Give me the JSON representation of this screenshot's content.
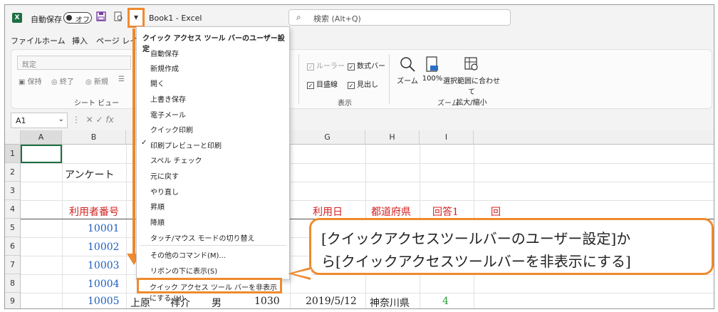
{
  "titlebar": {
    "logo": "X",
    "autosave_label": "自動保存",
    "autosave_state": "オフ",
    "book_title": "Book1 - Excel",
    "qa_dropdown_glyph": "▾",
    "search_placeholder": "検索 (Alt+Q)"
  },
  "tabs": [
    "ファイル",
    "ホーム",
    "挿入",
    "ページ レイ"
  ],
  "ribbon": {
    "sheetview_select": "既定",
    "sheetview_buttons": [
      "保持",
      "終了",
      "新規",
      "☰"
    ],
    "sheetview_label": "シート ビュー",
    "show_checks": [
      {
        "label": "ルーラー",
        "checked": true,
        "dim": true
      },
      {
        "label": "数式バー",
        "checked": true,
        "dim": false
      },
      {
        "label": "目盛線",
        "checked": true,
        "dim": false
      },
      {
        "label": "見出し",
        "checked": true,
        "dim": false
      }
    ],
    "show_label": "表示",
    "zoom_buttons": [
      "ズーム",
      "100%",
      "選択範囲に合わせて",
      "拡大/縮小"
    ],
    "zoom_label": "ズーム"
  },
  "formula_bar": {
    "name_box": "A1",
    "fx": "fx"
  },
  "grid": {
    "columns": [
      "A",
      "B",
      "G",
      "H",
      "I"
    ],
    "rows": [
      "1",
      "2",
      "3",
      "4",
      "5",
      "6",
      "7",
      "8",
      "9"
    ],
    "title_cell": "アンケート",
    "header_b": "利用者番号",
    "header_g": "利用日",
    "header_h": "都道府県",
    "header_i": "回答1",
    "header_j": "回",
    "ids": [
      "10001",
      "10002",
      "10003",
      "10004",
      "10005"
    ],
    "row9": {
      "c": "上原",
      "d": "祥介",
      "e": "男",
      "f": "1030",
      "g": "2019/5/12",
      "h": "神奈川県",
      "i": "4"
    }
  },
  "menu": {
    "title": "クイック アクセス ツール バーのユーザー設定",
    "items": [
      {
        "label": "自動保存",
        "checked": false
      },
      {
        "label": "新規作成",
        "checked": false
      },
      {
        "label": "開く",
        "checked": false
      },
      {
        "label": "上書き保存",
        "checked": false
      },
      {
        "label": "電子メール",
        "checked": false
      },
      {
        "label": "クイック印刷",
        "checked": false
      },
      {
        "label": "印刷プレビューと印刷",
        "checked": true
      },
      {
        "label": "スペル チェック",
        "checked": false
      },
      {
        "label": "元に戻す",
        "checked": false
      },
      {
        "label": "やり直し",
        "checked": false
      },
      {
        "label": "昇順",
        "checked": false
      },
      {
        "label": "降順",
        "checked": false
      },
      {
        "label": "タッチ/マウス モードの切り替え",
        "checked": false
      }
    ],
    "more_commands": "その他のコマンド(M)...",
    "show_below": "リボンの下に表示(S)",
    "hide_toolbar": "クイック アクセス ツール バーを非表示にする (H)",
    "check_glyph": "✓"
  },
  "callout": {
    "line1": "[クイックアクセスツールバーのユーザー設定]か",
    "line2": "ら[クイックアクセスツールバーを非表示にする]"
  },
  "colors": {
    "accent": "#ef8a2e",
    "excel_green": "#1d6f42",
    "red_text": "#d42121",
    "blue_text": "#1f5fbf"
  }
}
